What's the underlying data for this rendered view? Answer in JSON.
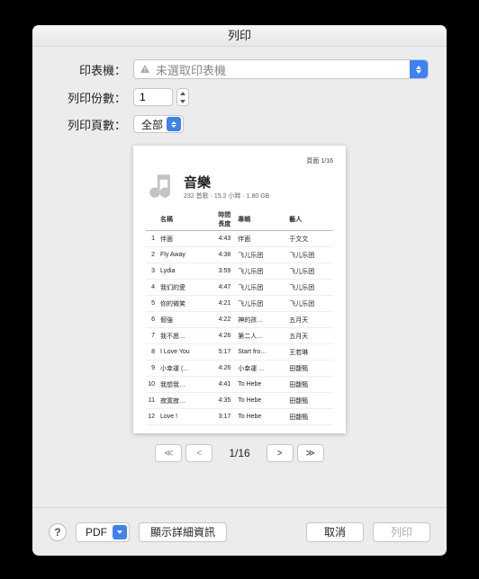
{
  "window": {
    "title": "列印"
  },
  "labels": {
    "printer": "印表機：",
    "copies": "列印份數：",
    "pages": "列印頁數："
  },
  "printer": {
    "placeholder": "未選取印表機"
  },
  "copies": {
    "value": "1"
  },
  "pages": {
    "selected": "全部"
  },
  "preview": {
    "page_counter": "頁面 1/16",
    "title": "音樂",
    "subtitle": "232 首歌 · 15.2 小時 · 1.80 GB",
    "columns": {
      "num": "",
      "name": "名稱",
      "duration": "時間長度",
      "album": "專輯",
      "artist": "藝人"
    },
    "rows": [
      {
        "n": "1",
        "name": "伴面",
        "dur": "4:43",
        "album": "伴面",
        "artist": "于文文"
      },
      {
        "n": "2",
        "name": "Fly Away",
        "dur": "4:38",
        "album": "飞儿乐团",
        "artist": "飞儿乐团"
      },
      {
        "n": "3",
        "name": "Lydia",
        "dur": "3:59",
        "album": "飞儿乐团",
        "artist": "飞儿乐团"
      },
      {
        "n": "4",
        "name": "我们的愛",
        "dur": "4:47",
        "album": "飞儿乐团",
        "artist": "飞儿乐团"
      },
      {
        "n": "5",
        "name": "你的微笑",
        "dur": "4:21",
        "album": "飞儿乐团",
        "artist": "飞儿乐团"
      },
      {
        "n": "6",
        "name": "倔強",
        "dur": "4:22",
        "album": "神的孩…",
        "artist": "五月天"
      },
      {
        "n": "7",
        "name": "我不愿…",
        "dur": "4:26",
        "album": "第二人…",
        "artist": "五月天"
      },
      {
        "n": "8",
        "name": "I Love You",
        "dur": "5:17",
        "album": "Start fro…",
        "artist": "王若琳"
      },
      {
        "n": "9",
        "name": "小幸運 (…",
        "dur": "4:26",
        "album": "小幸運 …",
        "artist": "田馥甄"
      },
      {
        "n": "10",
        "name": "我想我…",
        "dur": "4:41",
        "album": "To Hebe",
        "artist": "田馥甄"
      },
      {
        "n": "11",
        "name": "寂寞寂…",
        "dur": "4:35",
        "album": "To Hebe",
        "artist": "田馥甄"
      },
      {
        "n": "12",
        "name": "Love !",
        "dur": "3:17",
        "album": "To Hebe",
        "artist": "田馥甄"
      }
    ]
  },
  "pager": {
    "first": "≪",
    "prev": "<",
    "next": ">",
    "last": "≫",
    "label": "1/16"
  },
  "footer": {
    "help": "?",
    "pdf": "PDF",
    "details": "顯示詳細資訊",
    "cancel": "取消",
    "print": "列印"
  }
}
